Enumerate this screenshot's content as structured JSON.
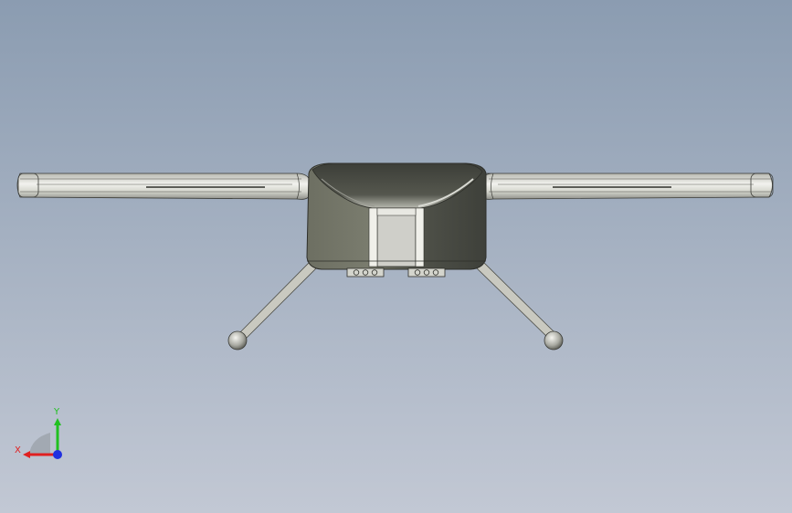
{
  "viewport": {
    "background_top": "#8b9cb1",
    "background_bottom": "#c2c8d4"
  },
  "model": {
    "body_color": "#5f6257",
    "arm_color": "#d9dad3",
    "leg_color": "#c9c9c0",
    "foot_color": "#9a9a92",
    "center_panel_color": "#cfcfc9"
  },
  "triad": {
    "x_label": "X",
    "y_label": "Y",
    "x_color": "#e02020",
    "y_color": "#20c020",
    "z_color": "#2030e0"
  }
}
